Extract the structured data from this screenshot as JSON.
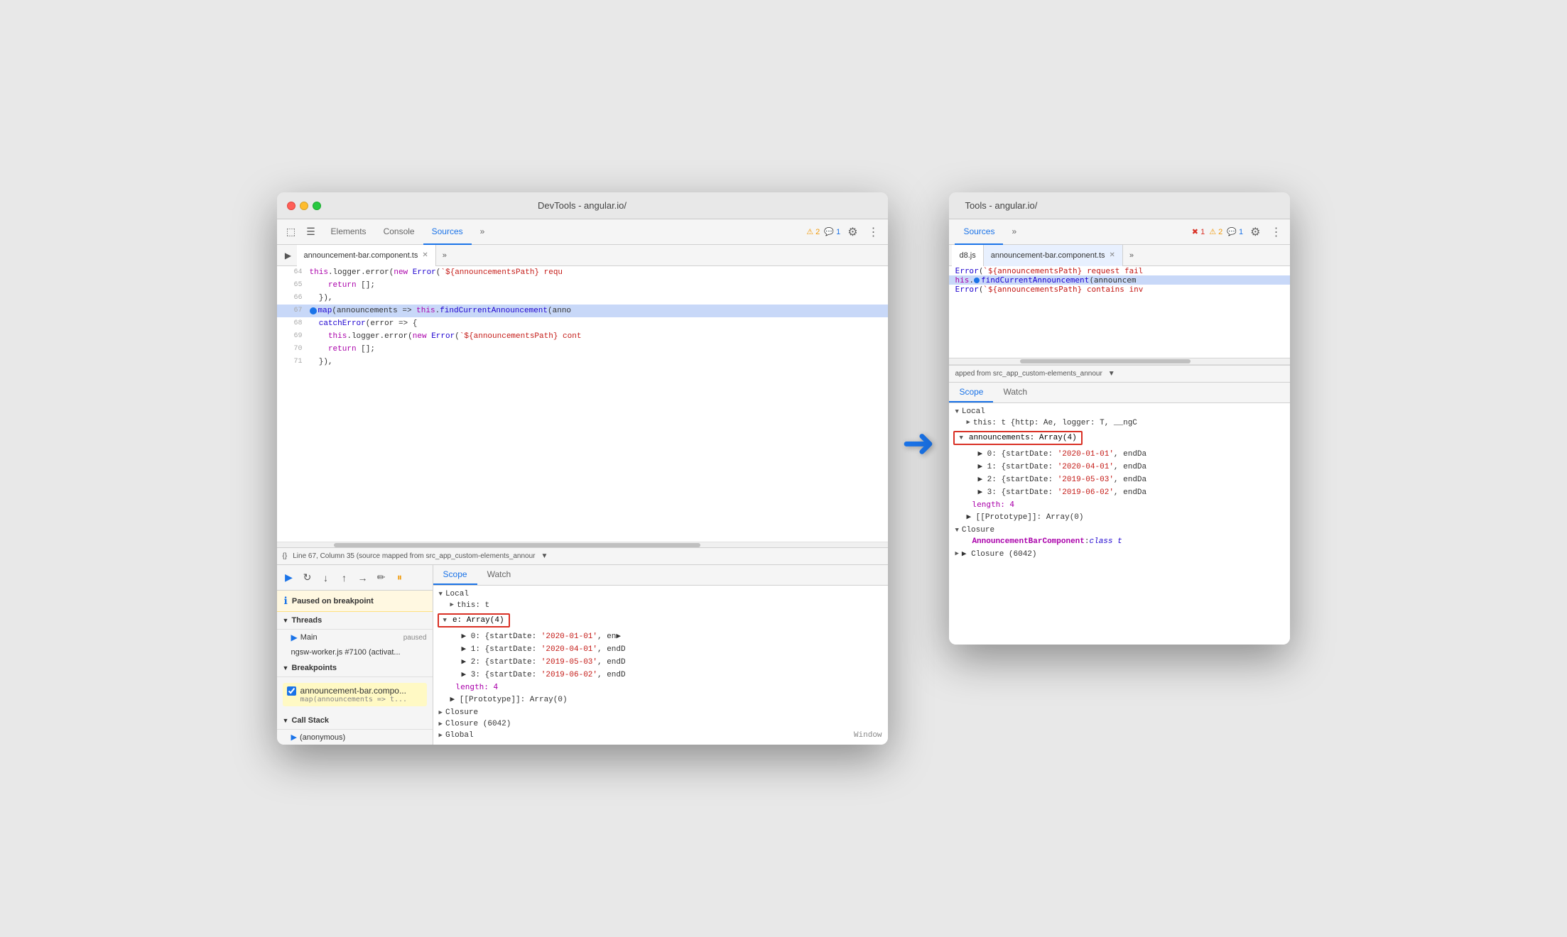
{
  "left_window": {
    "title": "DevTools - angular.io/",
    "tabs": [
      {
        "label": "Elements",
        "active": false
      },
      {
        "label": "Console",
        "active": false
      },
      {
        "label": "Sources",
        "active": true
      },
      {
        "label": "»",
        "active": false
      }
    ],
    "badges": {
      "warn": "⚠ 2",
      "chat": "💬 1"
    },
    "file_tab": "announcement-bar.component.ts",
    "code_lines": [
      {
        "num": "64",
        "content": "this.logger.error(new Error(`${announcementsPath} requ",
        "highlight": false
      },
      {
        "num": "65",
        "content": "return [];",
        "highlight": false
      },
      {
        "num": "66",
        "content": "}),",
        "highlight": false
      },
      {
        "num": "67",
        "content": "map(announcements => this.findCurrentAnnouncement(anno",
        "highlight": true,
        "breakpoint": true
      },
      {
        "num": "68",
        "content": "catchError(error => {",
        "highlight": false
      },
      {
        "num": "69",
        "content": "this.logger.error(new Error(`${announcementsPath} cont",
        "highlight": false
      },
      {
        "num": "70",
        "content": "return [];",
        "highlight": false
      },
      {
        "num": "71",
        "content": "}),",
        "highlight": false
      }
    ],
    "status_bar": "Line 67, Column 35 (source mapped from src_app_custom-elements_annour",
    "debug_buttons": [
      "▶",
      "⟳",
      "↓",
      "↑",
      "→",
      "✏",
      "⏸"
    ],
    "paused_message": "Paused on breakpoint",
    "sections": {
      "threads": {
        "label": "Threads",
        "items": [
          {
            "name": "Main",
            "status": "paused"
          },
          {
            "name": "ngsw-worker.js #7100 (activat...",
            "status": ""
          }
        ]
      },
      "breakpoints": {
        "label": "Breakpoints",
        "items": [
          {
            "file": "announcement-bar.compo...",
            "code": "map(announcements => t...",
            "checked": true
          }
        ]
      },
      "call_stack": {
        "label": "Call Stack",
        "items": [
          {
            "name": "(anonymous)"
          }
        ]
      }
    },
    "scope": {
      "tabs": [
        "Scope",
        "Watch"
      ],
      "active_tab": "Scope",
      "local": {
        "label": "Local",
        "this": "this: t",
        "e_highlighted": true,
        "e_label": "e: Array(4)",
        "items": [
          "▶ 0: {startDate: '2020-01-01', en▶",
          "▶ 1: {startDate: '2020-04-01', endD",
          "▶ 2: {startDate: '2019-05-03', endD",
          "▶ 3: {startDate: '2019-06-02', endD"
        ],
        "length": "length: 4",
        "prototype": "▶ [[Prototype]]: Array(0)"
      },
      "closure": "Closure",
      "closure2": "Closure (6042)",
      "global": "Global",
      "window_label": "Window"
    }
  },
  "right_window": {
    "title": "Tools - angular.io/",
    "tabs": [
      {
        "label": "Sources",
        "active": true
      },
      {
        "label": "»",
        "active": false
      }
    ],
    "badges": {
      "error": "✖ 1",
      "warn": "⚠ 2",
      "chat": "💬 1"
    },
    "file_tabs": [
      "d8.js",
      "announcement-bar.component.ts"
    ],
    "code_lines": [
      {
        "content": "Error(`${announcementsPath} request fail",
        "highlight": false
      },
      {
        "content": "his.findCurrentAnnouncement(announcem",
        "highlight": true
      },
      {
        "content": "Error(`${announcementsPath} contains inv",
        "highlight": false
      }
    ],
    "status_bar": "apped from src_app_custom-elements_annour",
    "scope": {
      "tabs": [
        "Scope",
        "Watch"
      ],
      "active_tab": "Scope",
      "local": {
        "label": "Local",
        "this": "this: t {http: Ae, logger: T, __ngC",
        "announcements_highlighted": true,
        "announcements_label": "announcements: Array(4)",
        "items": [
          "▶ 0: {startDate: '2020-01-01', endDa",
          "▶ 1: {startDate: '2020-04-01', endDa",
          "▶ 2: {startDate: '2019-05-03', endDa",
          "▶ 3: {startDate: '2019-06-02', endDa"
        ],
        "length": "length: 4",
        "prototype": "▶ [[Prototype]]: Array(0)"
      },
      "closure": "▼ Closure",
      "closure_item": "AnnouncementBarComponent: class t",
      "closure2": "▶ Closure (6042)"
    }
  },
  "arrow": "➜"
}
